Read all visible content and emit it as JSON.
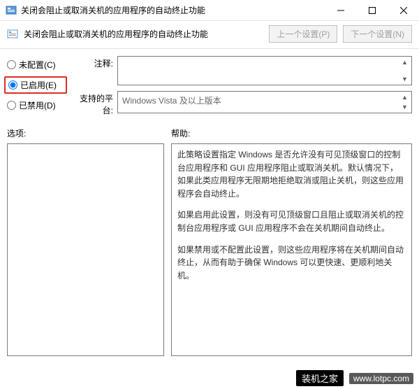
{
  "window": {
    "title": "关闭会阻止或取消关机的应用程序的自动终止功能"
  },
  "header": {
    "policy_title": "关闭会阻止或取消关机的应用程序的自动终止功能",
    "prev_btn": "上一个设置(P)",
    "next_btn": "下一个设置(N)"
  },
  "radios": {
    "not_configured": "未配置(C)",
    "enabled": "已启用(E)",
    "disabled": "已禁用(D)"
  },
  "fields": {
    "comment_label": "注释:",
    "comment_value": "",
    "platform_label": "支持的平台:",
    "platform_value": "Windows Vista 及以上版本"
  },
  "sections": {
    "options_label": "选项:",
    "help_label": "帮助:"
  },
  "help": {
    "p1": "此策略设置指定 Windows 是否允许没有可见顶级窗口的控制台应用程序和 GUI 应用程序阻止或取消关机。默认情况下，如果此类应用程序无限期地拒绝取消或阻止关机，则这些应用程序会自动终止。",
    "p2": "如果启用此设置，则没有可见顶级窗口且阻止或取消关机的控制台应用程序或 GUI 应用程序不会在关机期间自动终止。",
    "p3": "如果禁用或不配置此设置，则这些应用程序将在关机期间自动终止，从而有助于确保 Windows 可以更快速、更顺利地关机。"
  },
  "watermark": {
    "badge": "装机之家",
    "url": "www.lotpc.com"
  }
}
